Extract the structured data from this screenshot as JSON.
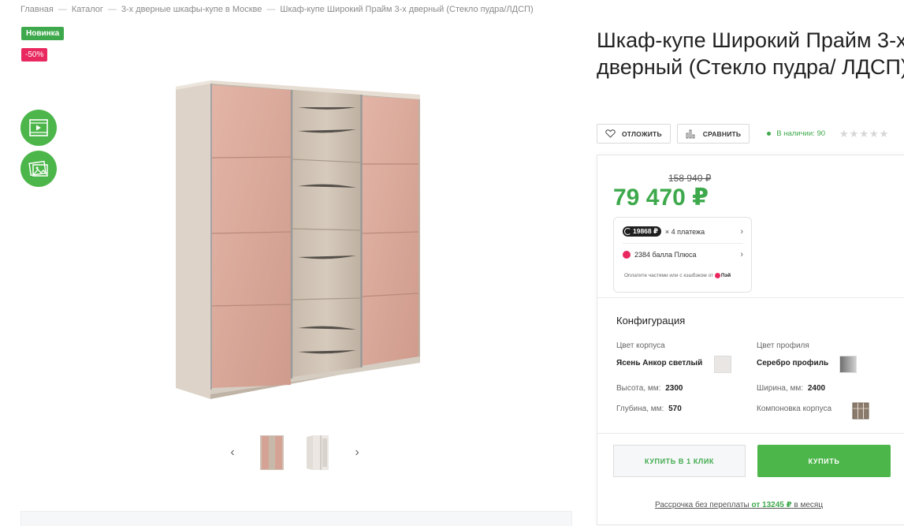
{
  "breadcrumb": {
    "items": [
      "Главная",
      "Каталог",
      "3-х дверные шкафы-купе в Москве",
      "Шкаф-купе Широкий Прайм 3-х дверный (Стекло пудра/ЛДСП)"
    ],
    "separator": "—"
  },
  "badges": {
    "new": "Новинка",
    "discount": "-50%"
  },
  "product": {
    "title": "Шкаф-купе Широкий Прайм 3-х дверный (Стекло пудра/ ЛДСП)",
    "actions": {
      "favorite": "ОТЛОЖИТЬ",
      "compare": "СРАВНИТЬ"
    },
    "stock": "В наличии: 90",
    "rating_stars": "★★★★★",
    "rating_value": 0
  },
  "gallery": {
    "prev_arrow": "‹",
    "next_arrow": "›",
    "thumbnail_count": 2
  },
  "price": {
    "old": "158 940 ₽",
    "current": "79 470 ₽",
    "split_amount": "19868 ₽",
    "split_text": "× 4 платежа",
    "plus_text": "2384 балла Плюса",
    "note_text": "Оплатите частями или с кэшбэком от",
    "note_brand": "Пэй"
  },
  "config": {
    "title": "Конфигурация",
    "body_color_label": "Цвет корпуса",
    "body_color_value": "Ясень Анкор светлый",
    "profile_color_label": "Цвет профиля",
    "profile_color_value": "Серебро профиль",
    "height_label": "Высота, мм:",
    "height_value": "2300",
    "width_label": "Ширина, мм:",
    "width_value": "2400",
    "depth_label": "Глубина, мм:",
    "depth_value": "570",
    "layout_label": "Компоновка корпуса"
  },
  "buttons": {
    "one_click": "КУПИТЬ В 1 КЛИК",
    "buy": "КУПИТЬ"
  },
  "installment": {
    "prefix": "Рассрочка без переплаты",
    "amount": "от 13245 ₽",
    "suffix": "в месяц"
  },
  "colors": {
    "accent_green": "#4cb64a",
    "price_green": "#3ea94c",
    "sale_pink": "#e8285e",
    "glass_powder": "#d9a99b",
    "oak_light": "#d8cbbd"
  },
  "icons": {
    "video": "video-play-icon",
    "gallery": "image-gallery-icon",
    "favorite": "heart-icon",
    "compare": "compare-bars-icon",
    "chevron": "chevron-right-icon"
  }
}
